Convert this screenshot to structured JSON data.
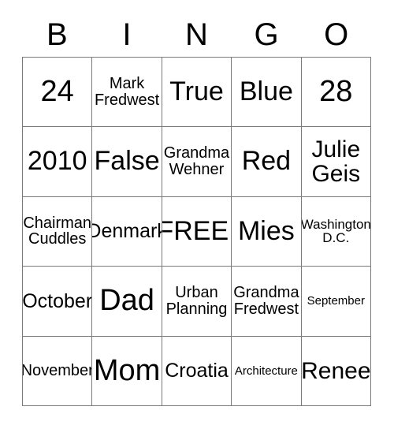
{
  "card": {
    "type": "bingo-card",
    "header_letters": [
      "B",
      "I",
      "N",
      "G",
      "O"
    ],
    "grid_size": "5x5",
    "free_space": "FREE!",
    "colors": {
      "background": "#ffffff",
      "text": "#000000",
      "grid_line": "#7a7a7a"
    },
    "rows": [
      [
        {
          "text": "24",
          "size": "fs-xxl"
        },
        {
          "text": "Mark\nFredwest",
          "size": "fs-s"
        },
        {
          "text": "True",
          "size": "fs-xl"
        },
        {
          "text": "Blue",
          "size": "fs-xl"
        },
        {
          "text": "28",
          "size": "fs-xxl"
        }
      ],
      [
        {
          "text": "2010",
          "size": "fs-xl"
        },
        {
          "text": "False",
          "size": "fs-xl"
        },
        {
          "text": "Grandma\nWehner",
          "size": "fs-s"
        },
        {
          "text": "Red",
          "size": "fs-xl"
        },
        {
          "text": "Julie\nGeis",
          "size": "fs-l"
        }
      ],
      [
        {
          "text": "Chairman\nCuddles",
          "size": "fs-s"
        },
        {
          "text": "Denmark",
          "size": "fs-m"
        },
        {
          "text": "FREE!",
          "size": "fs-xl"
        },
        {
          "text": "Mies",
          "size": "fs-xl"
        },
        {
          "text": "Washington\nD.C.",
          "size": "fs-xs"
        }
      ],
      [
        {
          "text": "October",
          "size": "fs-m"
        },
        {
          "text": "Dad",
          "size": "fs-xxl"
        },
        {
          "text": "Urban\nPlanning",
          "size": "fs-s"
        },
        {
          "text": "Grandma\nFredwest",
          "size": "fs-s"
        },
        {
          "text": "September",
          "size": "fs-xxs"
        }
      ],
      [
        {
          "text": "November",
          "size": "fs-s"
        },
        {
          "text": "Mom",
          "size": "fs-xxl"
        },
        {
          "text": "Croatia",
          "size": "fs-m"
        },
        {
          "text": "Architecture",
          "size": "fs-xxs"
        },
        {
          "text": "Renee",
          "size": "fs-l"
        }
      ]
    ]
  }
}
